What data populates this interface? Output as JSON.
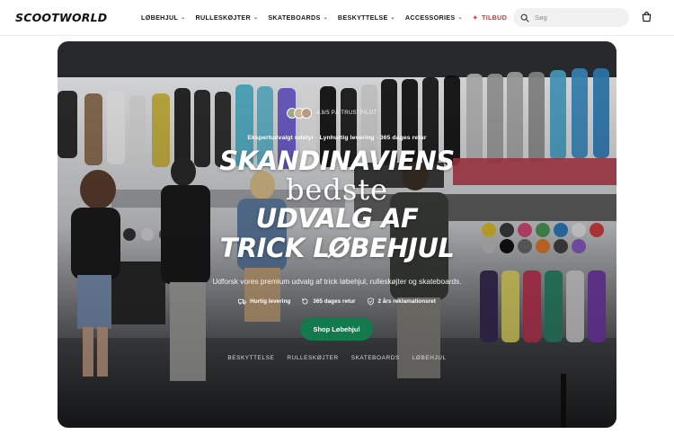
{
  "header": {
    "logo": "SCOOTWORLD",
    "nav": [
      {
        "label": "LØBEHJUL",
        "has_dropdown": true
      },
      {
        "label": "RULLESKØJTER",
        "has_dropdown": true
      },
      {
        "label": "SKATEBOARDS",
        "has_dropdown": true
      },
      {
        "label": "BESKYTTELSE",
        "has_dropdown": true
      },
      {
        "label": "ACCESSORIES",
        "has_dropdown": true
      },
      {
        "label": "TILBUD",
        "has_dropdown": false
      }
    ],
    "search_placeholder": "Søg",
    "cart_icon": "shopping-bag-icon",
    "sale_color": "#e03131"
  },
  "hero": {
    "trust_text": "4.8/5 PÅ TRUSTPILOT",
    "tagline": "Ekspertudvalgt udstyr · Lynhurtig levering · 365 dages retur",
    "title_lines": [
      "SKANDINAVIENS",
      "bedste",
      "UDVALG AF",
      "TRICK LØBEHJUL"
    ],
    "subtitle": "Udforsk vores premium udvalg af trick løbehjul, rulleskøjter og skateboards.",
    "features": [
      {
        "icon": "truck-icon",
        "label": "Hurtig levering"
      },
      {
        "icon": "return-icon",
        "label": "365 dages retur"
      },
      {
        "icon": "shield-check-icon",
        "label": "2 års reklamationsret"
      }
    ],
    "cta_label": "Shop Løbehjul",
    "cta_color": "#127a4c",
    "sublinks": [
      "BESKYTTELSE",
      "RULLESKØJTER",
      "SKATEBOARDS",
      "LØBEHJUL"
    ]
  }
}
